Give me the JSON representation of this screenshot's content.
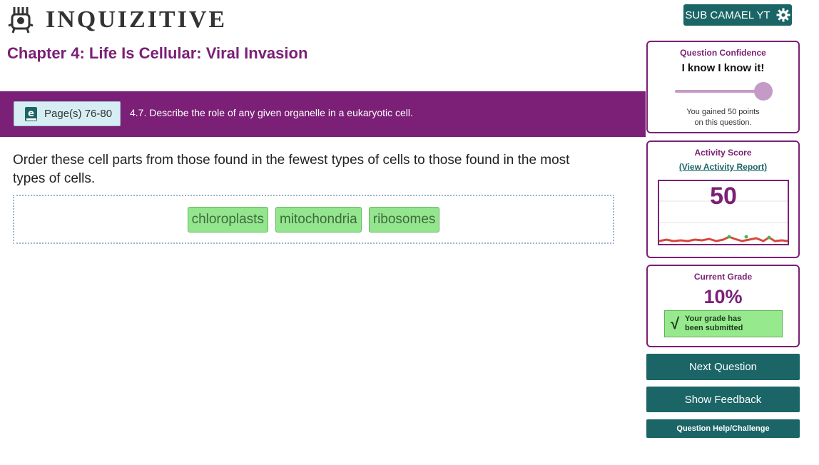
{
  "header": {
    "logo_text": "INQUIZITIVE",
    "user_label": "SUB CAMAEL YT",
    "settings_icon": "gear-icon"
  },
  "chapter": {
    "title": "Chapter 4: Life Is Cellular: Viral Invasion"
  },
  "objective": {
    "pages_label": "Page(s) 76-80",
    "pages_icon": "ebook-icon",
    "text": "4.7. Describe the role of any given organelle in a eukaryotic cell."
  },
  "question": {
    "text": "Order these cell parts from those found in the fewest types of cells to those found in the most types of cells.",
    "answers": [
      "chloroplasts",
      "mitochondria",
      "ribosomes"
    ]
  },
  "sidebar": {
    "confidence": {
      "label": "Question Confidence",
      "level": "I know I know it!",
      "slider_value": 1.0,
      "points_line1": "You gained 50 points",
      "points_line2": "on this question."
    },
    "activity": {
      "label": "Activity Score",
      "report_link": "(View Activity Report)",
      "score": "50"
    },
    "grade": {
      "label": "Current Grade",
      "value": "10%",
      "badge_line1": "Your grade has",
      "badge_line2": "been submitted"
    },
    "buttons": {
      "next": "Next Question",
      "feedback": "Show Feedback",
      "help": "Question Help/Challenge"
    }
  },
  "colors": {
    "brand_purple": "#7b2076",
    "teal": "#1b6566",
    "answer_green": "#94e68e"
  }
}
